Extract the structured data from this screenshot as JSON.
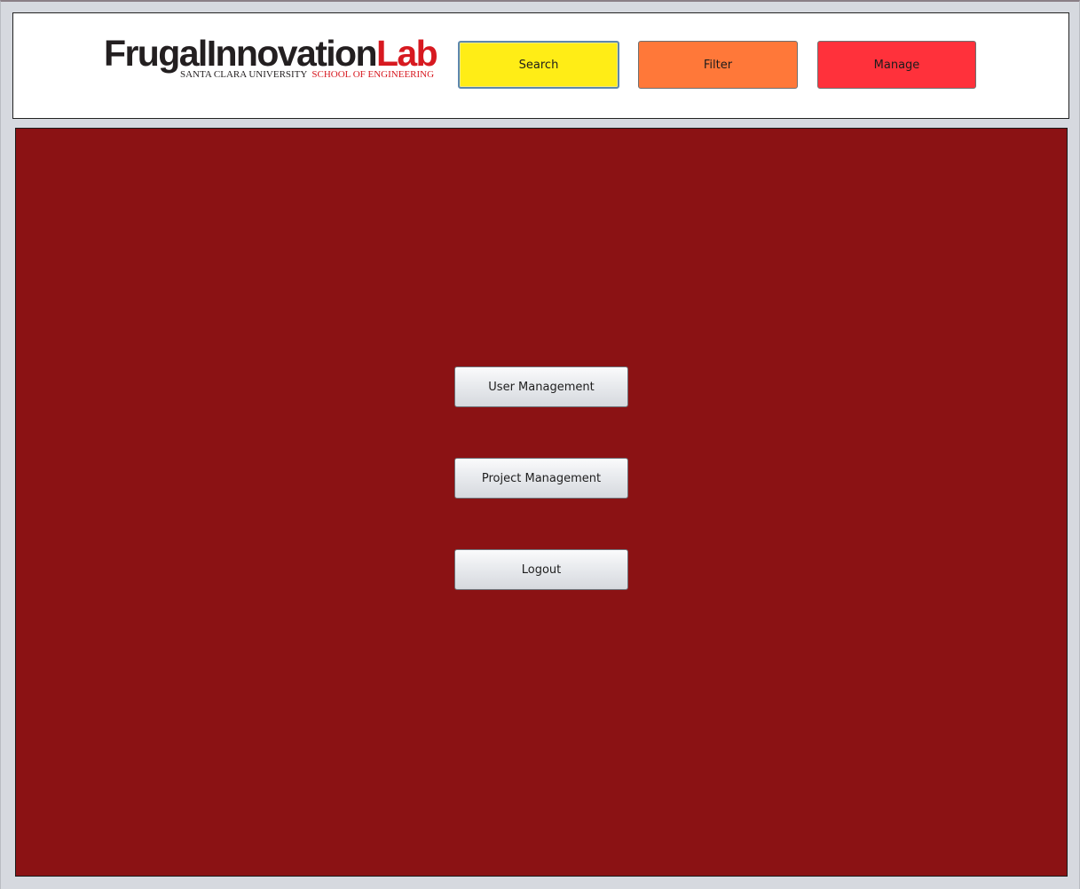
{
  "colors": {
    "window_background": "#d6d9df",
    "header_background": "#ffffff",
    "content_background": "#8b1214",
    "search_button": "#ffed16",
    "filter_button": "#ff7839",
    "manage_button": "#ff313b",
    "logo_dark": "#231f20",
    "logo_red": "#d71920"
  },
  "header": {
    "logo": {
      "word_frugal": "Frugal",
      "word_innovation": "Innovation",
      "word_lab": "Lab",
      "university": "SANTA CLARA UNIVERSITY",
      "school": "SCHOOL OF ENGINEERING"
    },
    "nav": {
      "search_label": "Search",
      "filter_label": "Filter",
      "manage_label": "Manage"
    }
  },
  "main": {
    "menu": {
      "user_management_label": "User Management",
      "project_management_label": "Project Management",
      "logout_label": "Logout"
    }
  }
}
